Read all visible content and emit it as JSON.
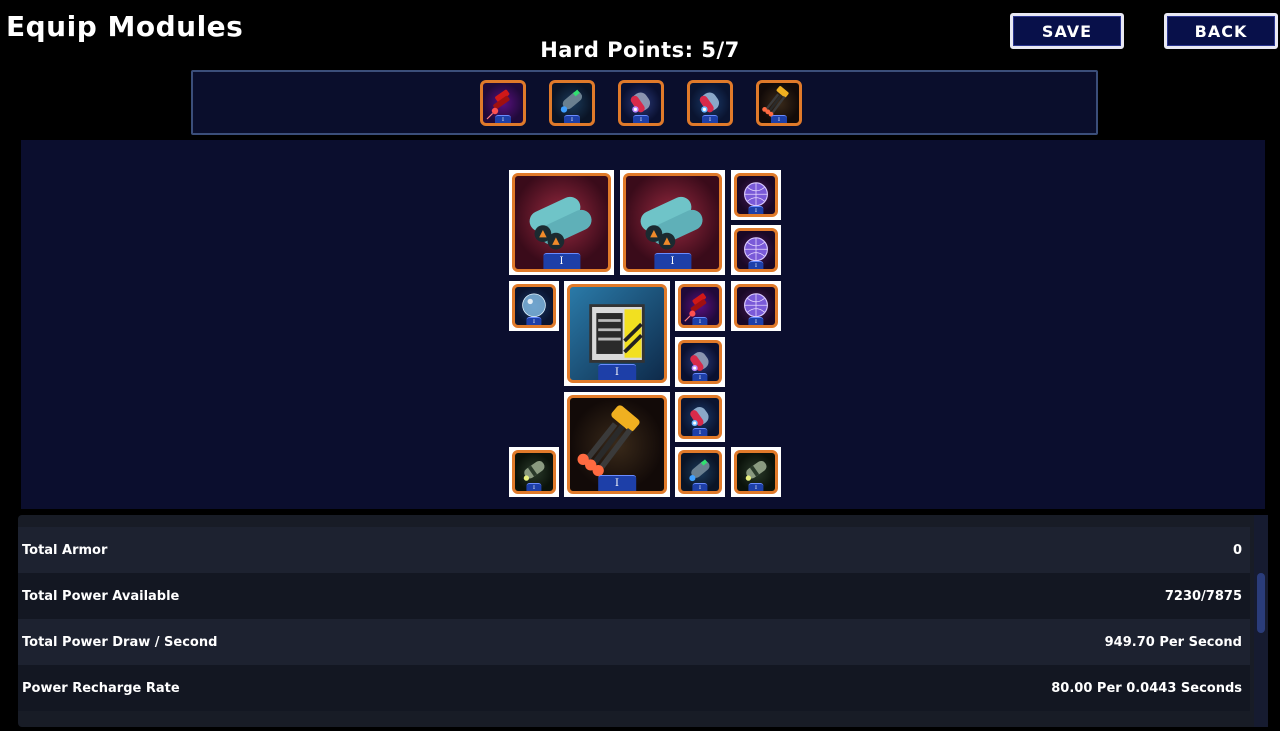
{
  "header": {
    "title": "Equip Modules",
    "hard_points_label": "Hard Points: 5/7",
    "save_label": "SAVE",
    "back_label": "BACK"
  },
  "hard_points": [
    {
      "icon": "red-laser-weapon-icon",
      "level": "I"
    },
    {
      "icon": "green-plasma-cannon-icon",
      "level": "I"
    },
    {
      "icon": "purple-missile-pod-icon",
      "level": "I"
    },
    {
      "icon": "blue-missile-pod-icon",
      "level": "I"
    },
    {
      "icon": "gold-gatling-gun-icon",
      "level": "I"
    }
  ],
  "ship_layout": [
    {
      "icon": "twin-thruster-icon",
      "level": "I",
      "size": "large"
    },
    {
      "icon": "twin-thruster-icon",
      "level": "I",
      "size": "large"
    },
    {
      "icon": "shield-sphere-icon",
      "level": "I",
      "size": "small"
    },
    {
      "icon": "shield-sphere-icon",
      "level": "I",
      "size": "small"
    },
    {
      "icon": "bubble-shield-icon",
      "level": "I",
      "size": "small"
    },
    {
      "icon": "power-core-icon",
      "level": "I",
      "size": "large"
    },
    {
      "icon": "red-laser-weapon-icon",
      "level": "I",
      "size": "small"
    },
    {
      "icon": "shield-sphere-icon",
      "level": "I",
      "size": "small"
    },
    {
      "icon": "purple-missile-pod-icon",
      "level": "I",
      "size": "small"
    },
    {
      "icon": "gold-gatling-gun-icon",
      "level": "I",
      "size": "large"
    },
    {
      "icon": "blue-missile-pod-icon",
      "level": "I",
      "size": "small"
    },
    {
      "icon": "energy-cell-icon",
      "level": "I",
      "size": "small"
    },
    {
      "icon": "green-plasma-cannon-icon",
      "level": "I",
      "size": "small"
    },
    {
      "icon": "energy-cell-icon",
      "level": "I",
      "size": "small"
    }
  ],
  "stats": [
    {
      "label": "Total Armor",
      "value": "0"
    },
    {
      "label": "Total Power Available",
      "value": "7230/7875"
    },
    {
      "label": "Total Power Draw / Second",
      "value": "949.70 Per Second"
    },
    {
      "label": "Power Recharge Rate",
      "value": "80.00 Per 0.0443 Seconds"
    }
  ],
  "colors": {
    "background": "#000000",
    "panel": "#0b0e2e",
    "tile_border": "#e07a2a",
    "button_bg": "#08104a",
    "button_border": "#e9e9f4",
    "level_badge": "#1d3fa8"
  }
}
